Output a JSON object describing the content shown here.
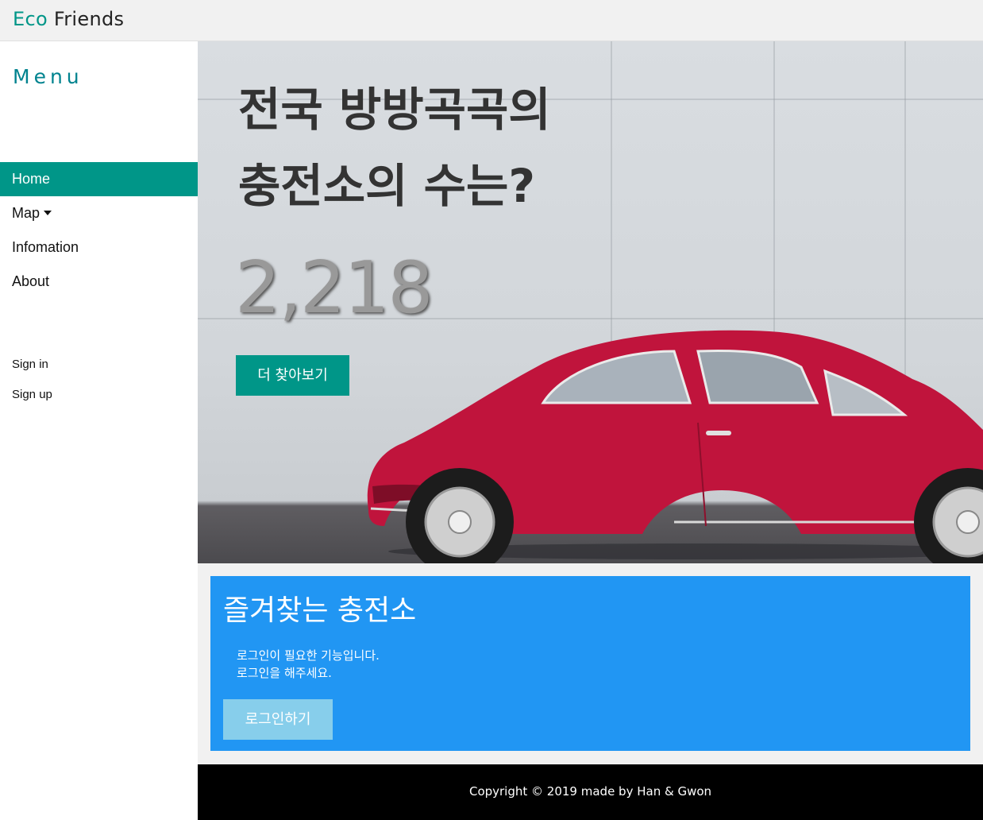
{
  "brand": {
    "part1": "Eco",
    "part2": " Friends"
  },
  "sidebar": {
    "title": "Menu",
    "items": [
      {
        "label": "Home"
      },
      {
        "label": "Map"
      },
      {
        "label": "Infomation"
      },
      {
        "label": "About"
      }
    ],
    "auth": [
      {
        "label": "Sign in"
      },
      {
        "label": "Sign up"
      }
    ]
  },
  "hero": {
    "title": "전국 방방곡곡의\n충전소의 수는?",
    "count": "2,218",
    "button": "더 찾아보기"
  },
  "favorites": {
    "title": "즐겨찾는 충전소",
    "message_line1": "로그인이 필요한 기능입니다.",
    "message_line2": "로그인을 해주세요.",
    "button": "로그인하기"
  },
  "footer": {
    "text": "Copyright © 2019 made by Han & Gwon"
  },
  "colors": {
    "accent": "#009688",
    "card": "#2196f3",
    "card_button": "#87ceeb",
    "car_red": "#c0143c"
  }
}
